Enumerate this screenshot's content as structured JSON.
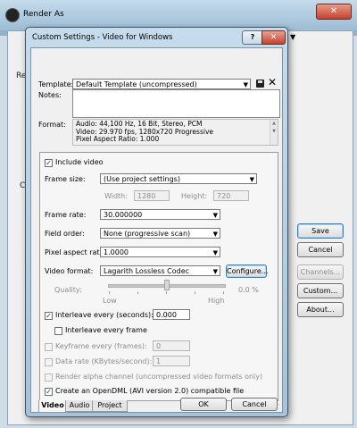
{
  "background_window": {
    "title": "Render As",
    "left_labels": [
      "Re",
      "C"
    ],
    "right_buttons": [
      {
        "label": "Save",
        "enabled": true,
        "default": true
      },
      {
        "label": "Cancel",
        "enabled": true,
        "default": false
      },
      {
        "label": "Channels...",
        "enabled": false,
        "default": false
      },
      {
        "label": "Custom...",
        "enabled": true,
        "default": false
      },
      {
        "label": "About...",
        "enabled": true,
        "default": false
      }
    ],
    "close_glyph": "✕"
  },
  "dialog": {
    "title": "Custom Settings - Video for Windows",
    "help_glyph": "?",
    "close_glyph": "✕",
    "template": {
      "label": "Template:",
      "value": "Default Template (uncompressed)",
      "save_icon": "save-icon",
      "delete_icon": "delete-icon"
    },
    "notes": {
      "label": "Notes:",
      "value": ""
    },
    "format": {
      "label": "Format:",
      "lines": [
        "Audio: 44,100 Hz, 16 Bit, Stereo, PCM",
        "Video: 29.970 fps, 1280x720 Progressive",
        "Pixel Aspect Ratio: 1.000"
      ]
    },
    "video": {
      "include_video": {
        "label": "Include video",
        "checked": true
      },
      "frame_size": {
        "label": "Frame size:",
        "value": "(Use project settings)"
      },
      "width": {
        "label": "Width:",
        "value": "1280"
      },
      "height": {
        "label": "Height:",
        "value": "720"
      },
      "frame_rate": {
        "label": "Frame rate:",
        "value": "30.000000"
      },
      "field_order": {
        "label": "Field order:",
        "value": "None (progressive scan)"
      },
      "pixel_aspect_ratio": {
        "label": "Pixel aspect ratio:",
        "value": "1.0000"
      },
      "video_format": {
        "label": "Video format:",
        "value": "Lagarith Lossless Codec"
      },
      "configure_button": "Configure...",
      "quality": {
        "label": "Quality:",
        "low": "Low",
        "high": "High",
        "value": "0.0 %",
        "level": 0.5
      },
      "interleave_every": {
        "label": "Interleave every (seconds):",
        "value": "0.000",
        "checked": true
      },
      "interleave_every_frame": {
        "label": "Interleave every frame",
        "checked": false
      },
      "keyframe_every": {
        "label": "Keyframe every (frames):",
        "value": "0",
        "checked": false
      },
      "data_rate": {
        "label": "Data rate (KBytes/second):",
        "value": "1",
        "checked": false
      },
      "render_alpha": {
        "label": "Render alpha channel (uncompressed video formats only)",
        "checked": false
      },
      "opendml": {
        "label": "Create an OpenDML (AVI version 2.0) compatible file",
        "checked": true
      }
    },
    "tabs": [
      {
        "label": "Video",
        "active": true
      },
      {
        "label": "Audio",
        "active": false
      },
      {
        "label": "Project",
        "active": false
      }
    ],
    "ok_button": "OK",
    "cancel_button": "Cancel"
  },
  "glyphs": {
    "dropdown_arrow": "▼",
    "check": "✓"
  }
}
